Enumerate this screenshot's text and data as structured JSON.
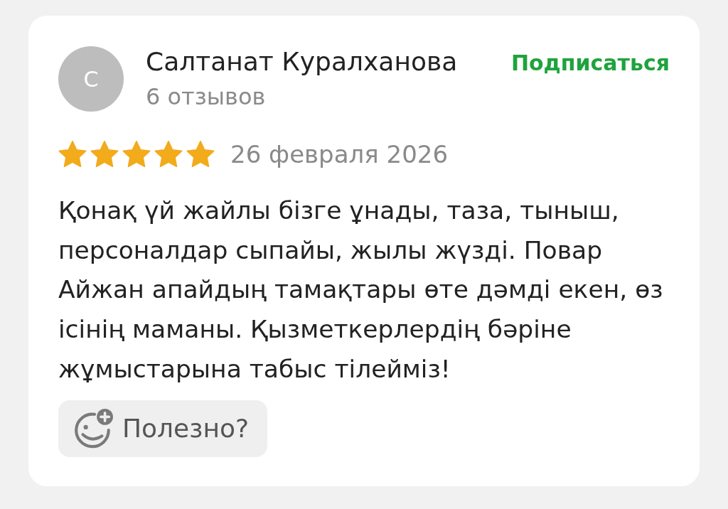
{
  "review": {
    "author": {
      "initial": "С",
      "name": "Салтанат Куралханова",
      "reviews_count": "6 отзывов"
    },
    "subscribe": "Подписаться",
    "stars": 5,
    "date": "26 февраля 2026",
    "text": "Қонақ үй жайлы бізге ұнады, таза, тыныш, персоналдар сыпайы, жылы жүзді. Повар Айжан апайдың тамақтары өте дәмді екен, өз ісінің маманы. Қызметкерлердің бәріне жұмыстарына табыс тілейміз!",
    "helpful_button": "Полезно?"
  }
}
